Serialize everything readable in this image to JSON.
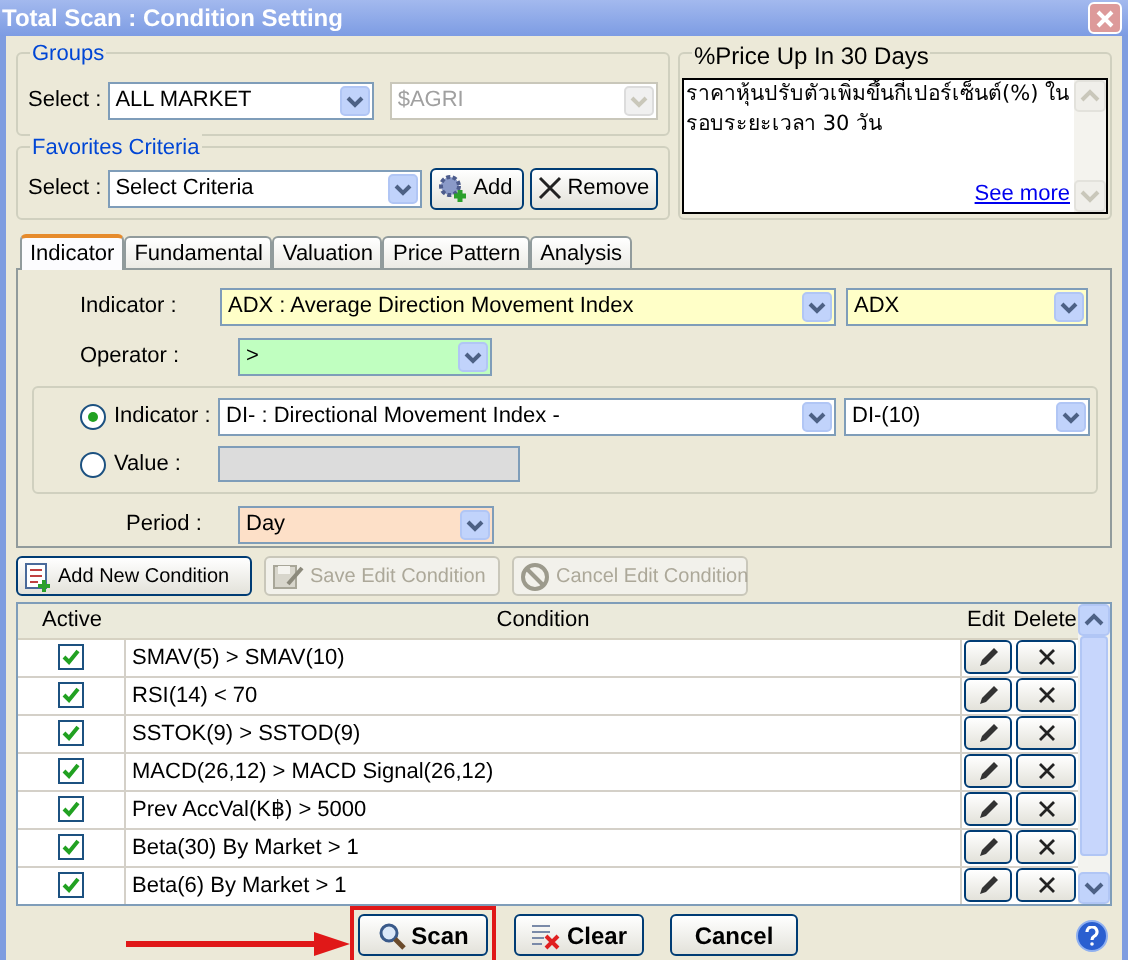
{
  "window": {
    "title": "Total Scan : Condition Setting"
  },
  "groups": {
    "title": "Groups",
    "label": "Select :",
    "market": "ALL MARKET",
    "sub_market": {
      "value": "$AGRI",
      "disabled": true
    }
  },
  "favorites": {
    "title": "Favorites Criteria",
    "label": "Select :",
    "criteria": "Select Criteria",
    "buttons": [
      {
        "kind": "add",
        "label": "Add"
      },
      {
        "kind": "remove",
        "label": "Remove"
      }
    ]
  },
  "description": {
    "title": "%Price Up In 30 Days",
    "text": "ราคาหุ้นปรับตัวเพิ่มขึ้นกี่เปอร์เซ็นต์(%) ในรอบระยะเวลา 30 วัน",
    "link": "See more"
  },
  "tabs": [
    {
      "label": "Indicator",
      "selected": true
    },
    {
      "label": "Fundamental",
      "selected": false
    },
    {
      "label": "Valuation",
      "selected": false
    },
    {
      "label": "Price Pattern",
      "selected": false
    },
    {
      "label": "Analysis",
      "selected": false
    }
  ],
  "form": {
    "indicator": {
      "label": "Indicator :",
      "value": "ADX : Average Direction Movement Index",
      "parameter": "ADX"
    },
    "operator": {
      "label": "Operator :",
      "value": ">"
    },
    "compare": [
      {
        "kind": "indicator",
        "label": "Indicator :",
        "selected": true,
        "value": "DI- : Directional Movement Index -",
        "parameter": "DI-(10)"
      },
      {
        "kind": "value",
        "label": "Value :",
        "selected": false,
        "disabled": true
      }
    ],
    "period": {
      "label": "Period :",
      "value": "Day"
    }
  },
  "actions": [
    {
      "kind": "add",
      "label": "Add New Condition",
      "disabled": false
    },
    {
      "kind": "save",
      "label": "Save Edit Condition",
      "disabled": true
    },
    {
      "kind": "cancel",
      "label": "Cancel Edit Condition",
      "disabled": true
    }
  ],
  "table": {
    "columns": [
      "Active",
      "Condition",
      "Edit",
      "Delete"
    ],
    "rows": [
      {
        "active": true,
        "condition": "SMAV(5) > SMAV(10)"
      },
      {
        "active": true,
        "condition": "RSI(14) < 70"
      },
      {
        "active": true,
        "condition": "SSTOK(9) > SSTOD(9)"
      },
      {
        "active": true,
        "condition": "MACD(26,12) > MACD Signal(26,12)"
      },
      {
        "active": true,
        "condition": "Prev AccVal(K฿) > 5000"
      },
      {
        "active": true,
        "condition": "Beta(30) By Market > 1"
      },
      {
        "active": true,
        "condition": "Beta(6) By Market > 1"
      }
    ]
  },
  "footer": {
    "buttons": [
      {
        "kind": "scan",
        "label": "Scan",
        "highlighted": true
      },
      {
        "kind": "clear",
        "label": "Clear",
        "highlighted": false
      },
      {
        "kind": "cancel",
        "label": "Cancel",
        "highlighted": false
      }
    ]
  }
}
